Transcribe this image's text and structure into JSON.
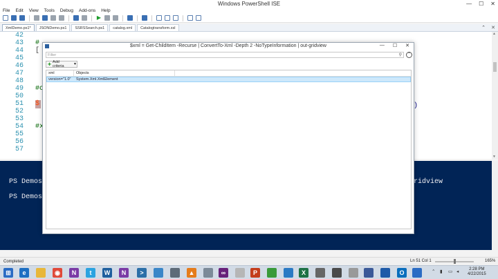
{
  "window": {
    "title": "Windows PowerShell ISE",
    "minimize": "—",
    "maximize": "☐",
    "close": "✕"
  },
  "menu": [
    "File",
    "Edit",
    "View",
    "Tools",
    "Debug",
    "Add-ons",
    "Help"
  ],
  "tabs": [
    {
      "label": "XmlDemo.ps1*",
      "active": true
    },
    {
      "label": "JSONDemo.ps1",
      "active": false
    },
    {
      "label": "SSRSSearch.ps1",
      "active": false
    },
    {
      "label": "catalog.xml",
      "active": false
    },
    {
      "label": "Catalogtransform.xsl",
      "active": false
    }
  ],
  "tab_close": "✕",
  "editor": {
    "line_numbers": [
      "42",
      "43",
      "44",
      "45",
      "46",
      "47",
      "48",
      "49",
      "50",
      "51",
      "52",
      "53",
      "54",
      "55",
      "56",
      "57"
    ],
    "visible_fragments": [
      {
        "line": "43",
        "text": "#"
      },
      {
        "line": "44",
        "text": "["
      },
      {
        "line": "49",
        "text": "#c"
      },
      {
        "line": "51",
        "text": "$"
      },
      {
        "line": "54",
        "text": "#x"
      }
    ],
    "right_fragment": ")"
  },
  "console": {
    "lines": [
      {
        "left": "PS Demos",
        "right": "ridview"
      },
      {
        "left": "PS Demos",
        "right": ""
      }
    ]
  },
  "status": {
    "text": "Completed",
    "position": "Ln 51  Col 1",
    "zoom": "165%"
  },
  "grid_view": {
    "title": "$xml = Get-ChildItem -Recurse | ConvertTo-Xml -Depth 2 -NoTypeInformation | out-gridview",
    "filter_placeholder": "Filter",
    "add_criteria_label": "Add criteria",
    "columns": [
      "xml",
      "Objects"
    ],
    "rows": [
      {
        "xml": "version=\"1.0\"",
        "objects": "System.Xml.XmlElement"
      }
    ]
  },
  "taskbar": {
    "clock_time": "2:28 PM",
    "clock_date": "4/22/2015"
  },
  "colors": {
    "console_background": "#012456",
    "selection": "#cde8fb",
    "line_number": "#2b91af",
    "comment": "#006400"
  }
}
